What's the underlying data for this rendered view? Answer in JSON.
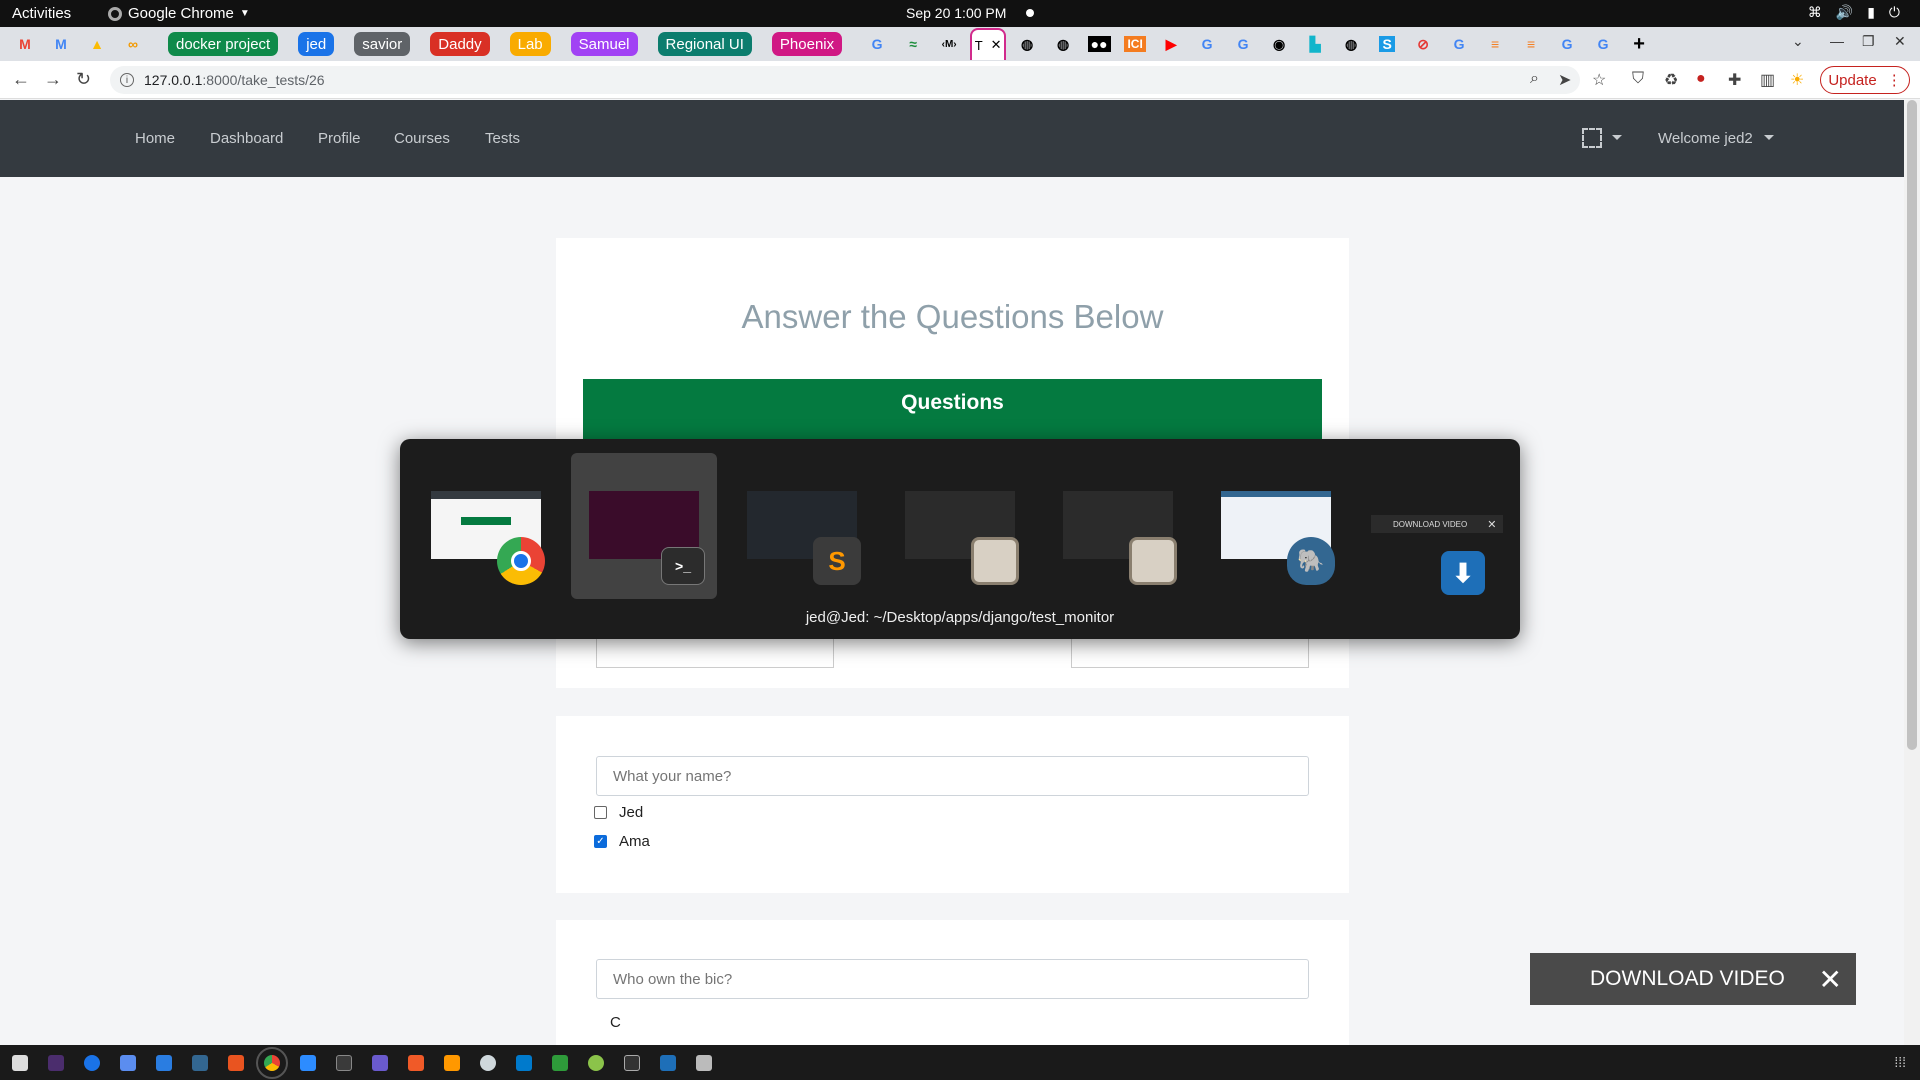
{
  "system_bar": {
    "activities": "Activities",
    "app_name": "Google Chrome",
    "datetime": "Sep 20  1:00 PM"
  },
  "tab_groups": [
    {
      "label": "docker project",
      "color": "#0f8a4a"
    },
    {
      "label": "jed",
      "color": "#1a73e8"
    },
    {
      "label": "savior",
      "color": "#5f6368"
    },
    {
      "label": "Daddy",
      "color": "#d93025"
    },
    {
      "label": "Lab",
      "color": "#f9ab00"
    },
    {
      "label": "Samuel",
      "color": "#a142f4"
    },
    {
      "label": "Regional UI",
      "color": "#0c7d6e"
    },
    {
      "label": "Phoenix",
      "color": "#d01884"
    }
  ],
  "active_tab_title": "T",
  "tab_ici_label": "ICI",
  "browser": {
    "url_host": "127.0.0.1",
    "url_rest": ":8000/take_tests/26",
    "update_label": "Update"
  },
  "site_nav": {
    "links": [
      "Home",
      "Dashboard",
      "Profile",
      "Courses",
      "Tests"
    ],
    "welcome": "Welcome jed2"
  },
  "page": {
    "title": "Answer the Questions Below",
    "questions_header": "Questions"
  },
  "questions": [
    {
      "prompt": "What your name?",
      "options": [
        {
          "label": "Jed",
          "checked": false
        },
        {
          "label": "Ama",
          "checked": true
        }
      ]
    },
    {
      "prompt": "Who own the bic?",
      "options": [
        {
          "label": "C",
          "checked": false
        }
      ]
    }
  ],
  "switcher": {
    "caption": "jed@Jed: ~/Desktop/apps/django/test_monitor",
    "mini_download_label": "DOWNLOAD VIDEO",
    "terminal_glyph": ">_",
    "sublime_glyph": "S"
  },
  "download_overlay": {
    "label": "DOWNLOAD VIDEO"
  }
}
